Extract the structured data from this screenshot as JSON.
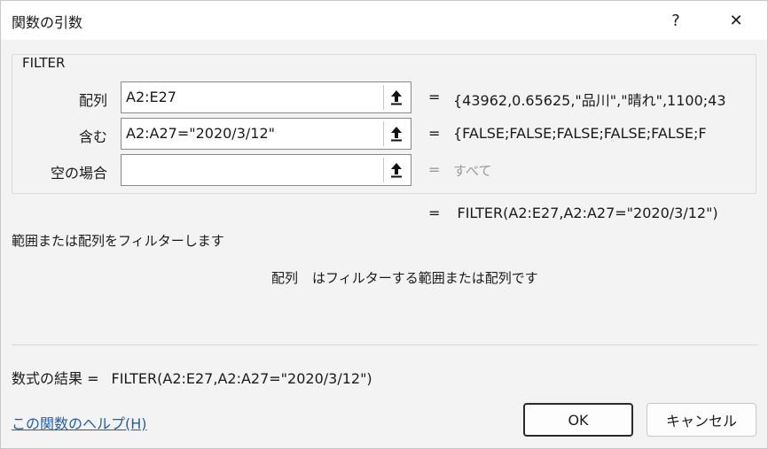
{
  "window": {
    "title": "関数の引数",
    "help_glyph": "?",
    "close_glyph": "✕"
  },
  "function_name": "FILTER",
  "arguments": [
    {
      "label": "配列",
      "value": "A2:E27",
      "result": "{43962,0.65625,\"品川\",\"晴れ\",1100;43"
    },
    {
      "label": "含む",
      "value": "A2:A27=\"2020/3/12\"",
      "result": "{FALSE;FALSE;FALSE;FALSE;FALSE;F"
    },
    {
      "label": "空の場合",
      "value": "",
      "result": "すべて"
    }
  ],
  "equals": "=",
  "formula_preview": "FILTER(A2:E27,A2:A27=\"2020/3/12\")",
  "description": "範囲または配列をフィルターします",
  "argument_help": {
    "name": "配列",
    "text": "はフィルターする範囲または配列です"
  },
  "result": {
    "label": "数式の結果 =",
    "value": "FILTER(A2:E27,A2:A27=\"2020/3/12\")"
  },
  "help_link": "この関数のヘルプ(H)",
  "buttons": {
    "ok": "OK",
    "cancel": "キャンセル"
  },
  "icons": {
    "collapse": "collapse-dialog-icon"
  }
}
